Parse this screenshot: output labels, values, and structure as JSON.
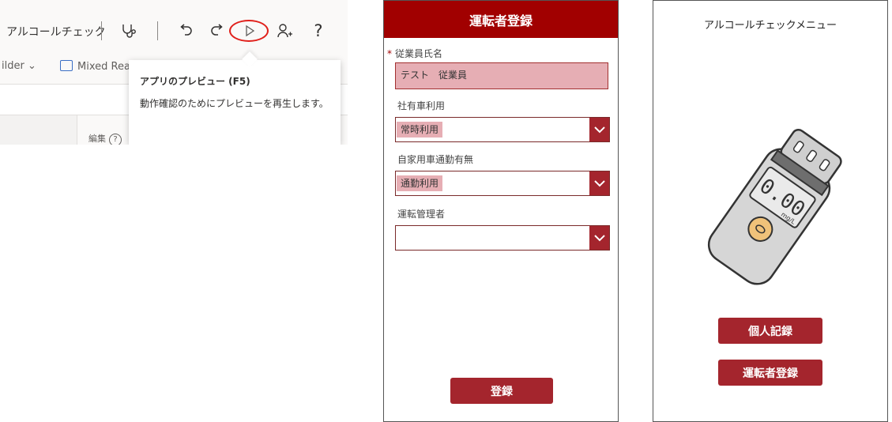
{
  "studio": {
    "app_title": "アルコールチェック",
    "toolbar_icons": [
      "stethoscope-icon",
      "undo-icon",
      "redo-icon",
      "play-icon",
      "person-add-icon",
      "help-icon"
    ],
    "help_label": "?",
    "ribbon": {
      "builder_label": "ilder ⌄",
      "mixed_label": "Mixed Rea"
    },
    "tooltip": {
      "title": "アプリのプレビュー (F5)",
      "desc": "動作確認のためにプレビューを再生します。"
    },
    "edit_label": "編集",
    "edit_help": "?",
    "highlight_color": "#e0201b"
  },
  "register": {
    "header": "運転者登録",
    "header_color": "#a10000",
    "required_mark": "*",
    "employee_label": "従業員氏名",
    "employee_value": "テスト　従業員",
    "company_car_label": "社有車利用",
    "company_car_value": "常時利用",
    "own_car_label": "自家用車通勤有無",
    "own_car_value": "通勤利用",
    "manager_label": "運転管理者",
    "manager_value": "",
    "submit_label": "登録",
    "accent_color": "#a4252d"
  },
  "menu": {
    "title": "アルコールチェックメニュー",
    "device_reading": "0.00",
    "device_unit": "mg/L",
    "button_personal": "個人記録",
    "button_register": "運転者登録"
  }
}
